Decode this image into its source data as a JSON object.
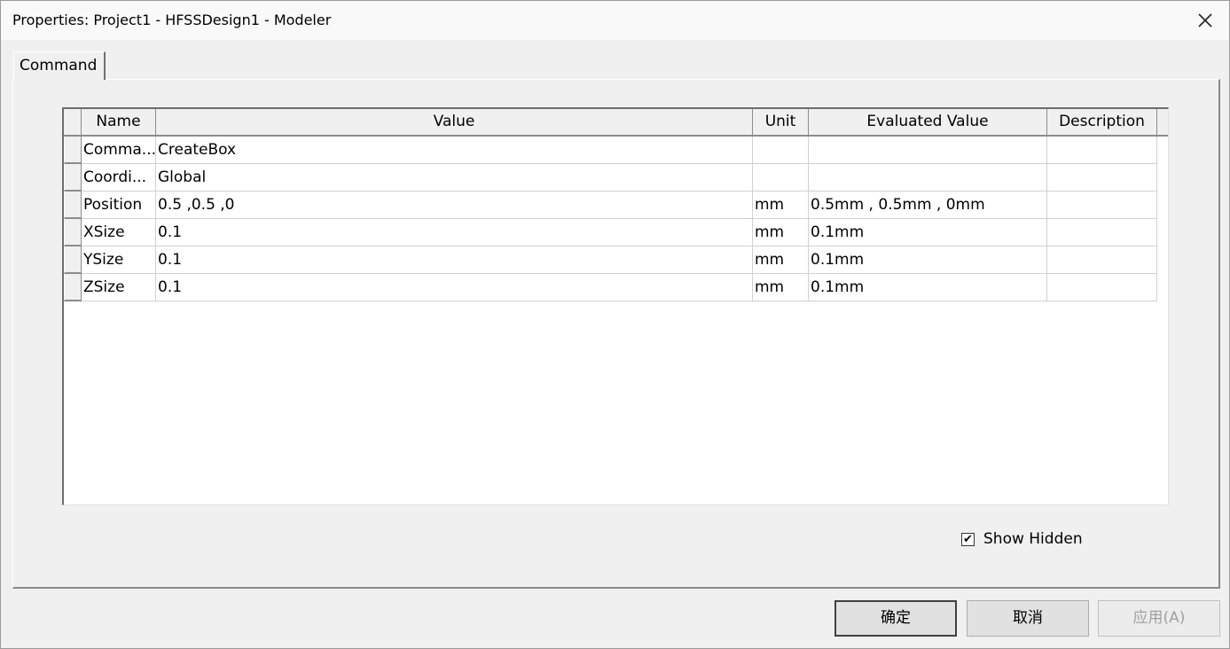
{
  "window": {
    "title": "Properties: Project1 - HFSSDesign1 - Modeler",
    "close_glyph": "✕"
  },
  "tabs": [
    {
      "label": "Command",
      "active": true
    }
  ],
  "grid": {
    "columns": [
      "Name",
      "Value",
      "Unit",
      "Evaluated Value",
      "Description"
    ],
    "rows": [
      {
        "name": "Comma...",
        "value": "CreateBox",
        "unit": "",
        "evaluated": "",
        "description": ""
      },
      {
        "name": "Coordi...",
        "value": "Global",
        "unit": "",
        "evaluated": "",
        "description": ""
      },
      {
        "name": "Position",
        "value": "0.5 ,0.5 ,0",
        "unit": "mm",
        "evaluated": "0.5mm , 0.5mm , 0mm",
        "description": ""
      },
      {
        "name": "XSize",
        "value": "0.1",
        "unit": "mm",
        "evaluated": "0.1mm",
        "description": ""
      },
      {
        "name": "YSize",
        "value": "0.1",
        "unit": "mm",
        "evaluated": "0.1mm",
        "description": ""
      },
      {
        "name": "ZSize",
        "value": "0.1",
        "unit": "mm",
        "evaluated": "0.1mm",
        "description": ""
      }
    ]
  },
  "show_hidden": {
    "label": "Show Hidden",
    "checked": true,
    "check_glyph": "✔"
  },
  "buttons": {
    "ok": "确定",
    "cancel": "取消",
    "apply": "应用(A)"
  }
}
